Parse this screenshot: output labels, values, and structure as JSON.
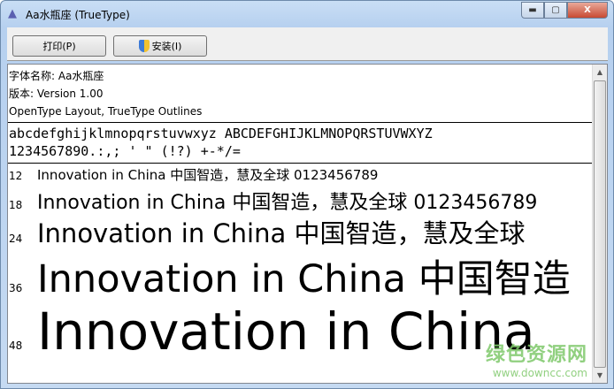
{
  "window": {
    "title": "Aa水瓶座 (TrueType)",
    "min": "▬",
    "max": "▢",
    "close": "X"
  },
  "toolbar": {
    "print_label": "打印(P)",
    "install_label": "安装(I)"
  },
  "info": {
    "name": "字体名称: Aa水瓶座",
    "version": "版本: Version 1.00",
    "type": "OpenType Layout, TrueType Outlines"
  },
  "charset": {
    "line1": "abcdefghijklmnopqrstuvwxyz ABCDEFGHIJKLMNOPQRSTUVWXYZ",
    "line2": "1234567890.:,; ' \" (!?) +-*/="
  },
  "samples": [
    {
      "size": "12",
      "text": "Innovation in China 中国智造，慧及全球 0123456789"
    },
    {
      "size": "18",
      "text": "Innovation in China 中国智造，慧及全球 0123456789"
    },
    {
      "size": "24",
      "text": "Innovation in China 中国智造，慧及全球"
    },
    {
      "size": "36",
      "text": "Innovation in China 中国智造"
    },
    {
      "size": "48",
      "text": "Innovation in China"
    }
  ],
  "watermark": {
    "cn": "绿色资源网",
    "url": "www.downcc.com"
  }
}
